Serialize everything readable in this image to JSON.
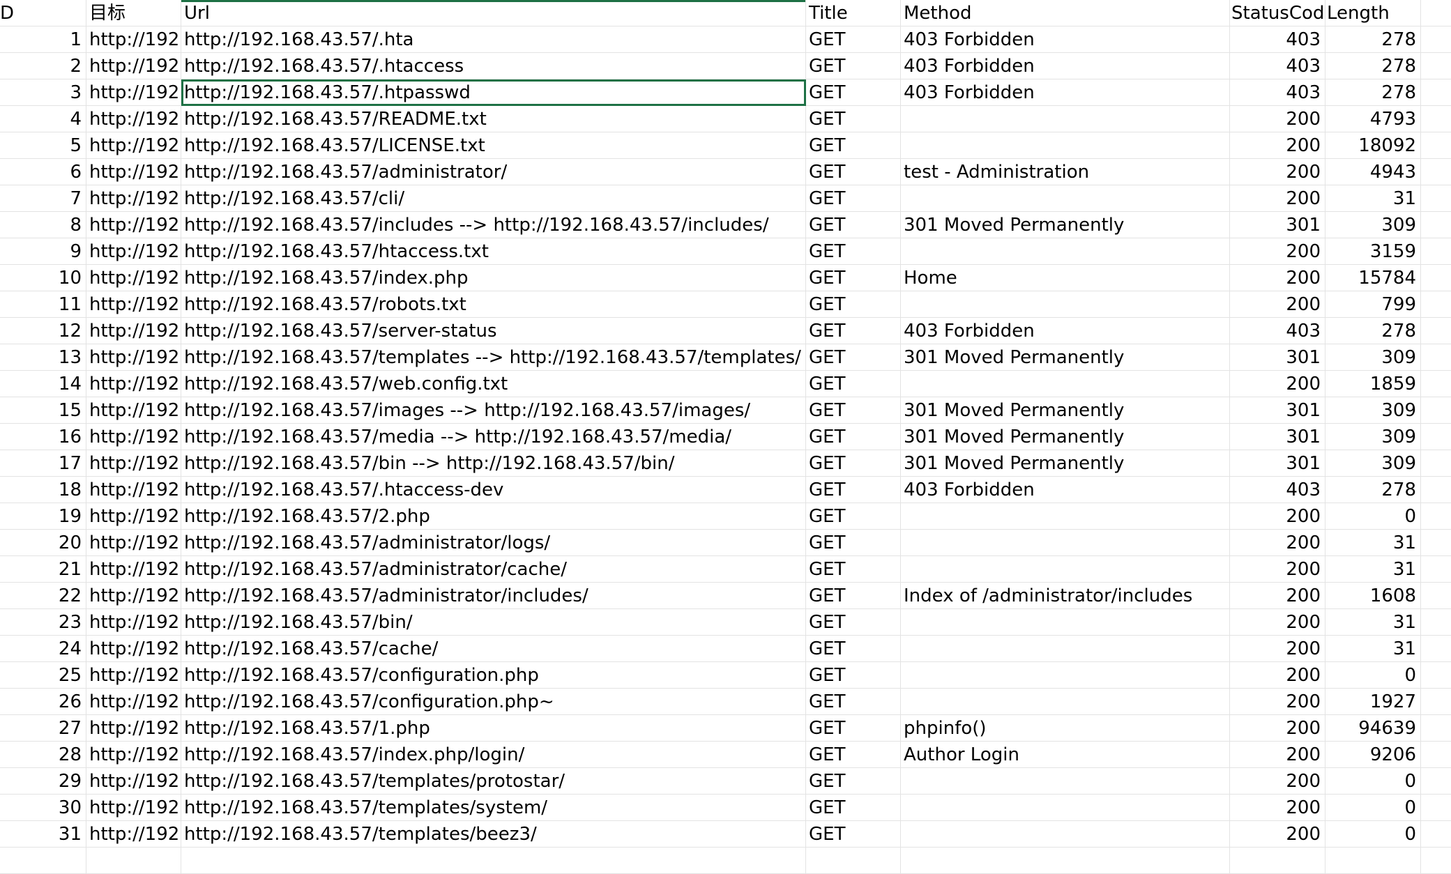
{
  "columns": {
    "d": "D",
    "target": "目标",
    "url": "Url",
    "title": "Title",
    "method": "Method",
    "status": "StatusCode",
    "length": "Length"
  },
  "selected_row": 3,
  "rows": [
    {
      "d": "1",
      "target": "http://192.",
      "url": "http://192.168.43.57/.hta",
      "title": "GET",
      "method": "403 Forbidden",
      "status": "403",
      "length": "278"
    },
    {
      "d": "2",
      "target": "http://192.",
      "url": "http://192.168.43.57/.htaccess",
      "title": "GET",
      "method": "403 Forbidden",
      "status": "403",
      "length": "278"
    },
    {
      "d": "3",
      "target": "http://192.",
      "url": "http://192.168.43.57/.htpasswd",
      "title": "GET",
      "method": "403 Forbidden",
      "status": "403",
      "length": "278"
    },
    {
      "d": "4",
      "target": "http://192.",
      "url": "http://192.168.43.57/README.txt",
      "title": "GET",
      "method": "",
      "status": "200",
      "length": "4793"
    },
    {
      "d": "5",
      "target": "http://192.",
      "url": "http://192.168.43.57/LICENSE.txt",
      "title": "GET",
      "method": "",
      "status": "200",
      "length": "18092"
    },
    {
      "d": "6",
      "target": "http://192.",
      "url": "http://192.168.43.57/administrator/",
      "title": "GET",
      "method": "test - Administration",
      "status": "200",
      "length": "4943"
    },
    {
      "d": "7",
      "target": "http://192.",
      "url": "http://192.168.43.57/cli/",
      "title": "GET",
      "method": "",
      "status": "200",
      "length": "31"
    },
    {
      "d": "8",
      "target": "http://192.",
      "url": "http://192.168.43.57/includes --> http://192.168.43.57/includes/",
      "title": "GET",
      "method": "301 Moved Permanently",
      "status": "301",
      "length": "309"
    },
    {
      "d": "9",
      "target": "http://192.",
      "url": "http://192.168.43.57/htaccess.txt",
      "title": "GET",
      "method": "",
      "status": "200",
      "length": "3159"
    },
    {
      "d": "10",
      "target": "http://192.",
      "url": "http://192.168.43.57/index.php",
      "title": "GET",
      "method": "Home",
      "status": "200",
      "length": "15784"
    },
    {
      "d": "11",
      "target": "http://192.",
      "url": "http://192.168.43.57/robots.txt",
      "title": "GET",
      "method": "",
      "status": "200",
      "length": "799"
    },
    {
      "d": "12",
      "target": "http://192.",
      "url": "http://192.168.43.57/server-status",
      "title": "GET",
      "method": "403 Forbidden",
      "status": "403",
      "length": "278"
    },
    {
      "d": "13",
      "target": "http://192.",
      "url": "http://192.168.43.57/templates --> http://192.168.43.57/templates/",
      "title": "GET",
      "method": "301 Moved Permanently",
      "status": "301",
      "length": "309"
    },
    {
      "d": "14",
      "target": "http://192.",
      "url": "http://192.168.43.57/web.config.txt",
      "title": "GET",
      "method": "",
      "status": "200",
      "length": "1859"
    },
    {
      "d": "15",
      "target": "http://192.",
      "url": "http://192.168.43.57/images --> http://192.168.43.57/images/",
      "title": "GET",
      "method": "301 Moved Permanently",
      "status": "301",
      "length": "309"
    },
    {
      "d": "16",
      "target": "http://192.",
      "url": "http://192.168.43.57/media --> http://192.168.43.57/media/",
      "title": "GET",
      "method": "301 Moved Permanently",
      "status": "301",
      "length": "309"
    },
    {
      "d": "17",
      "target": "http://192.",
      "url": "http://192.168.43.57/bin --> http://192.168.43.57/bin/",
      "title": "GET",
      "method": "301 Moved Permanently",
      "status": "301",
      "length": "309"
    },
    {
      "d": "18",
      "target": "http://192.",
      "url": "http://192.168.43.57/.htaccess-dev",
      "title": "GET",
      "method": "403 Forbidden",
      "status": "403",
      "length": "278"
    },
    {
      "d": "19",
      "target": "http://192.",
      "url": "http://192.168.43.57/2.php",
      "title": "GET",
      "method": "",
      "status": "200",
      "length": "0"
    },
    {
      "d": "20",
      "target": "http://192.",
      "url": "http://192.168.43.57/administrator/logs/",
      "title": "GET",
      "method": "",
      "status": "200",
      "length": "31"
    },
    {
      "d": "21",
      "target": "http://192.",
      "url": "http://192.168.43.57/administrator/cache/",
      "title": "GET",
      "method": "",
      "status": "200",
      "length": "31"
    },
    {
      "d": "22",
      "target": "http://192.",
      "url": "http://192.168.43.57/administrator/includes/",
      "title": "GET",
      "method": "Index of /administrator/includes",
      "status": "200",
      "length": "1608"
    },
    {
      "d": "23",
      "target": "http://192.",
      "url": "http://192.168.43.57/bin/",
      "title": "GET",
      "method": "",
      "status": "200",
      "length": "31"
    },
    {
      "d": "24",
      "target": "http://192.",
      "url": "http://192.168.43.57/cache/",
      "title": "GET",
      "method": "",
      "status": "200",
      "length": "31"
    },
    {
      "d": "25",
      "target": "http://192.",
      "url": "http://192.168.43.57/configuration.php",
      "title": "GET",
      "method": "",
      "status": "200",
      "length": "0"
    },
    {
      "d": "26",
      "target": "http://192.",
      "url": "http://192.168.43.57/configuration.php~",
      "title": "GET",
      "method": "",
      "status": "200",
      "length": "1927"
    },
    {
      "d": "27",
      "target": "http://192.",
      "url": "http://192.168.43.57/1.php",
      "title": "GET",
      "method": "phpinfo()",
      "status": "200",
      "length": "94639"
    },
    {
      "d": "28",
      "target": "http://192.",
      "url": "http://192.168.43.57/index.php/login/",
      "title": "GET",
      "method": "Author Login",
      "status": "200",
      "length": "9206"
    },
    {
      "d": "29",
      "target": "http://192.",
      "url": "http://192.168.43.57/templates/protostar/",
      "title": "GET",
      "method": "",
      "status": "200",
      "length": "0"
    },
    {
      "d": "30",
      "target": "http://192.",
      "url": "http://192.168.43.57/templates/system/",
      "title": "GET",
      "method": "",
      "status": "200",
      "length": "0"
    },
    {
      "d": "31",
      "target": "http://192.",
      "url": "http://192.168.43.57/templates/beez3/",
      "title": "GET",
      "method": "",
      "status": "200",
      "length": "0"
    }
  ]
}
